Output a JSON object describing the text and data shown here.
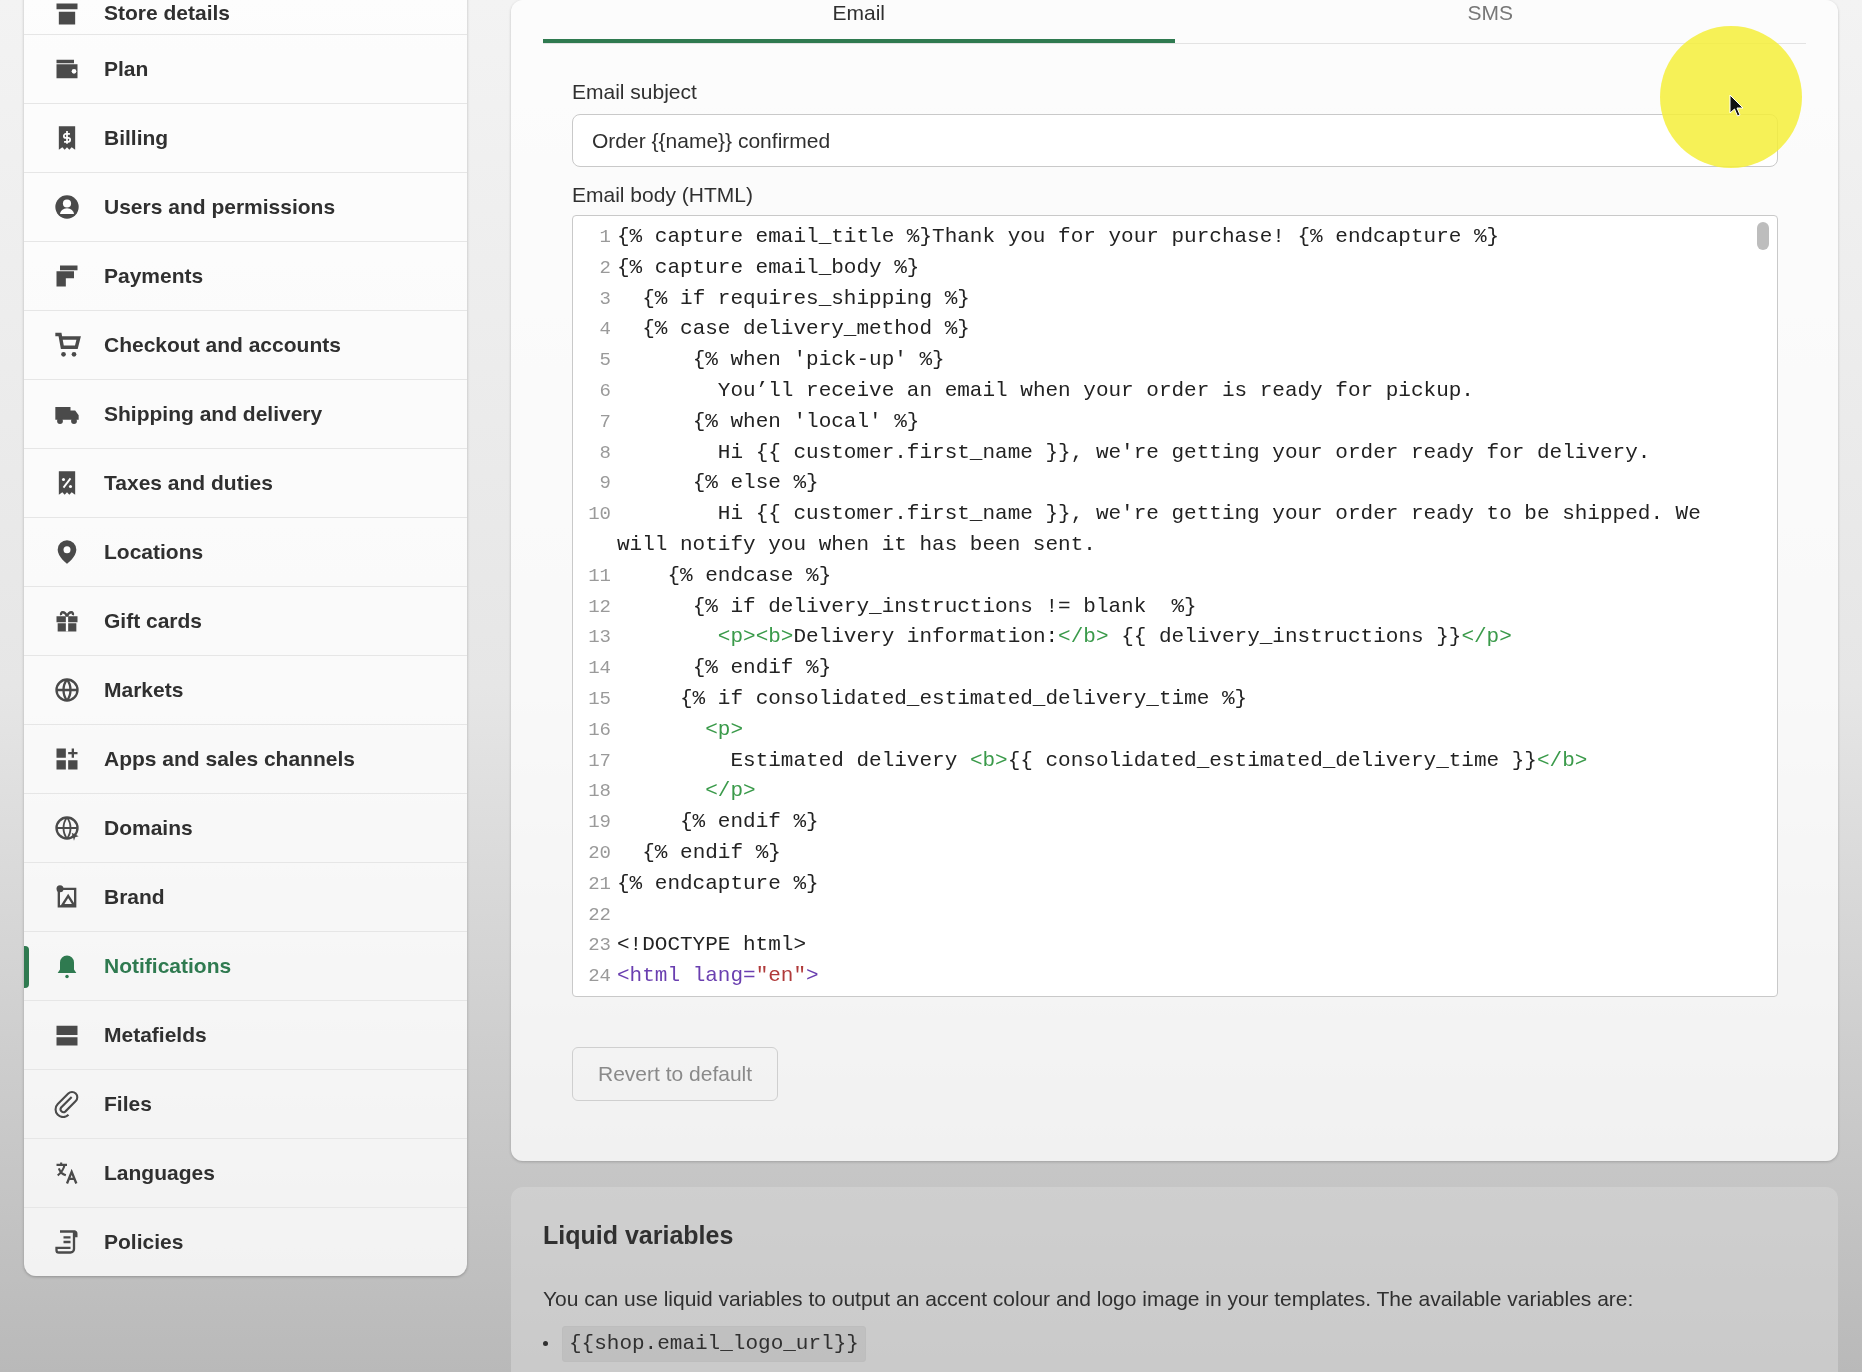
{
  "sidebar": {
    "items": [
      {
        "label": "Store details",
        "selected": false
      },
      {
        "label": "Plan",
        "selected": false
      },
      {
        "label": "Billing",
        "selected": false
      },
      {
        "label": "Users and permissions",
        "selected": false
      },
      {
        "label": "Payments",
        "selected": false
      },
      {
        "label": "Checkout and accounts",
        "selected": false
      },
      {
        "label": "Shipping and delivery",
        "selected": false
      },
      {
        "label": "Taxes and duties",
        "selected": false
      },
      {
        "label": "Locations",
        "selected": false
      },
      {
        "label": "Gift cards",
        "selected": false
      },
      {
        "label": "Markets",
        "selected": false
      },
      {
        "label": "Apps and sales channels",
        "selected": false
      },
      {
        "label": "Domains",
        "selected": false
      },
      {
        "label": "Brand",
        "selected": false
      },
      {
        "label": "Notifications",
        "selected": true
      },
      {
        "label": "Metafields",
        "selected": false
      },
      {
        "label": "Files",
        "selected": false
      },
      {
        "label": "Languages",
        "selected": false
      },
      {
        "label": "Policies",
        "selected": false
      }
    ]
  },
  "tabs": [
    {
      "label": "Email",
      "selected": true
    },
    {
      "label": "SMS",
      "selected": false
    }
  ],
  "email_subject": {
    "label": "Email subject",
    "value": "Order {{name}} confirmed"
  },
  "email_body": {
    "label": "Email body (HTML)",
    "lines": [
      {
        "number": "1",
        "parts": [
          {
            "kind": "text",
            "text": "{% capture email_title %}Thank you for your purchase! {% endcapture %}"
          }
        ]
      },
      {
        "number": "2",
        "parts": [
          {
            "kind": "text",
            "text": "{% capture email_body %}"
          }
        ]
      },
      {
        "number": "3",
        "parts": [
          {
            "kind": "text",
            "text": "  {% if requires_shipping %}"
          }
        ]
      },
      {
        "number": "4",
        "parts": [
          {
            "kind": "text",
            "text": "  {% case delivery_method %}"
          }
        ]
      },
      {
        "number": "5",
        "parts": [
          {
            "kind": "text",
            "text": "      {% when 'pick-up' %}"
          }
        ]
      },
      {
        "number": "6",
        "parts": [
          {
            "kind": "text",
            "text": "        You’ll receive an email when your order is ready for pickup."
          }
        ]
      },
      {
        "number": "7",
        "parts": [
          {
            "kind": "text",
            "text": "      {% when 'local' %}"
          }
        ]
      },
      {
        "number": "8",
        "parts": [
          {
            "kind": "text",
            "text": "        Hi {{ customer.first_name }}, we're getting your order ready for delivery."
          }
        ]
      },
      {
        "number": "9",
        "parts": [
          {
            "kind": "text",
            "text": "      {% else %}"
          }
        ]
      },
      {
        "number": "10",
        "parts": [
          {
            "kind": "text",
            "text": "        Hi {{ customer.first_name }}, we're getting your order ready to be shipped. We will notify you when it has been sent."
          }
        ]
      },
      {
        "number": "11",
        "parts": [
          {
            "kind": "text",
            "text": "    {% endcase %}"
          }
        ]
      },
      {
        "number": "12",
        "parts": [
          {
            "kind": "text",
            "text": "      {% if delivery_instructions != blank  %}"
          }
        ]
      },
      {
        "number": "13",
        "parts": [
          {
            "kind": "tag",
            "text": "        <p><b>"
          },
          {
            "kind": "text",
            "text": "Delivery information:"
          },
          {
            "kind": "tag",
            "text": "</b>"
          },
          {
            "kind": "text",
            "text": " {{ delivery_instructions }}"
          },
          {
            "kind": "tag",
            "text": "</p>"
          }
        ]
      },
      {
        "number": "14",
        "parts": [
          {
            "kind": "text",
            "text": "      {% endif %}"
          }
        ]
      },
      {
        "number": "15",
        "parts": [
          {
            "kind": "text",
            "text": "     {% if consolidated_estimated_delivery_time %}"
          }
        ]
      },
      {
        "number": "16",
        "parts": [
          {
            "kind": "tag",
            "text": "       <p>"
          }
        ]
      },
      {
        "number": "17",
        "parts": [
          {
            "kind": "text",
            "text": "         Estimated delivery "
          },
          {
            "kind": "tag",
            "text": "<b>"
          },
          {
            "kind": "text",
            "text": "{{ consolidated_estimated_delivery_time }}"
          },
          {
            "kind": "tag",
            "text": "</b>"
          }
        ]
      },
      {
        "number": "18",
        "parts": [
          {
            "kind": "tag",
            "text": "       </p>"
          }
        ]
      },
      {
        "number": "19",
        "parts": [
          {
            "kind": "text",
            "text": "     {% endif %}"
          }
        ]
      },
      {
        "number": "20",
        "parts": [
          {
            "kind": "text",
            "text": "  {% endif %}"
          }
        ]
      },
      {
        "number": "21",
        "parts": [
          {
            "kind": "text",
            "text": "{% endcapture %}"
          }
        ]
      },
      {
        "number": "22"
      },
      {
        "number": "23",
        "parts": [
          {
            "kind": "text",
            "text": "<!DOCTYPE html>"
          }
        ]
      },
      {
        "number": "24",
        "parts": [
          {
            "kind": "html",
            "text": "<html "
          },
          {
            "kind": "attr",
            "text": "lang="
          },
          {
            "kind": "string",
            "text": "\"en\""
          },
          {
            "kind": "html",
            "text": ">"
          }
        ]
      }
    ]
  },
  "revert_button": {
    "label": "Revert to default",
    "disabled": true
  },
  "liquid_variables": {
    "title": "Liquid variables",
    "text": "You can use liquid variables to output an accent colour and logo image in your templates. The available variables are:",
    "variables": [
      "{{shop.email_logo_url}}"
    ]
  }
}
